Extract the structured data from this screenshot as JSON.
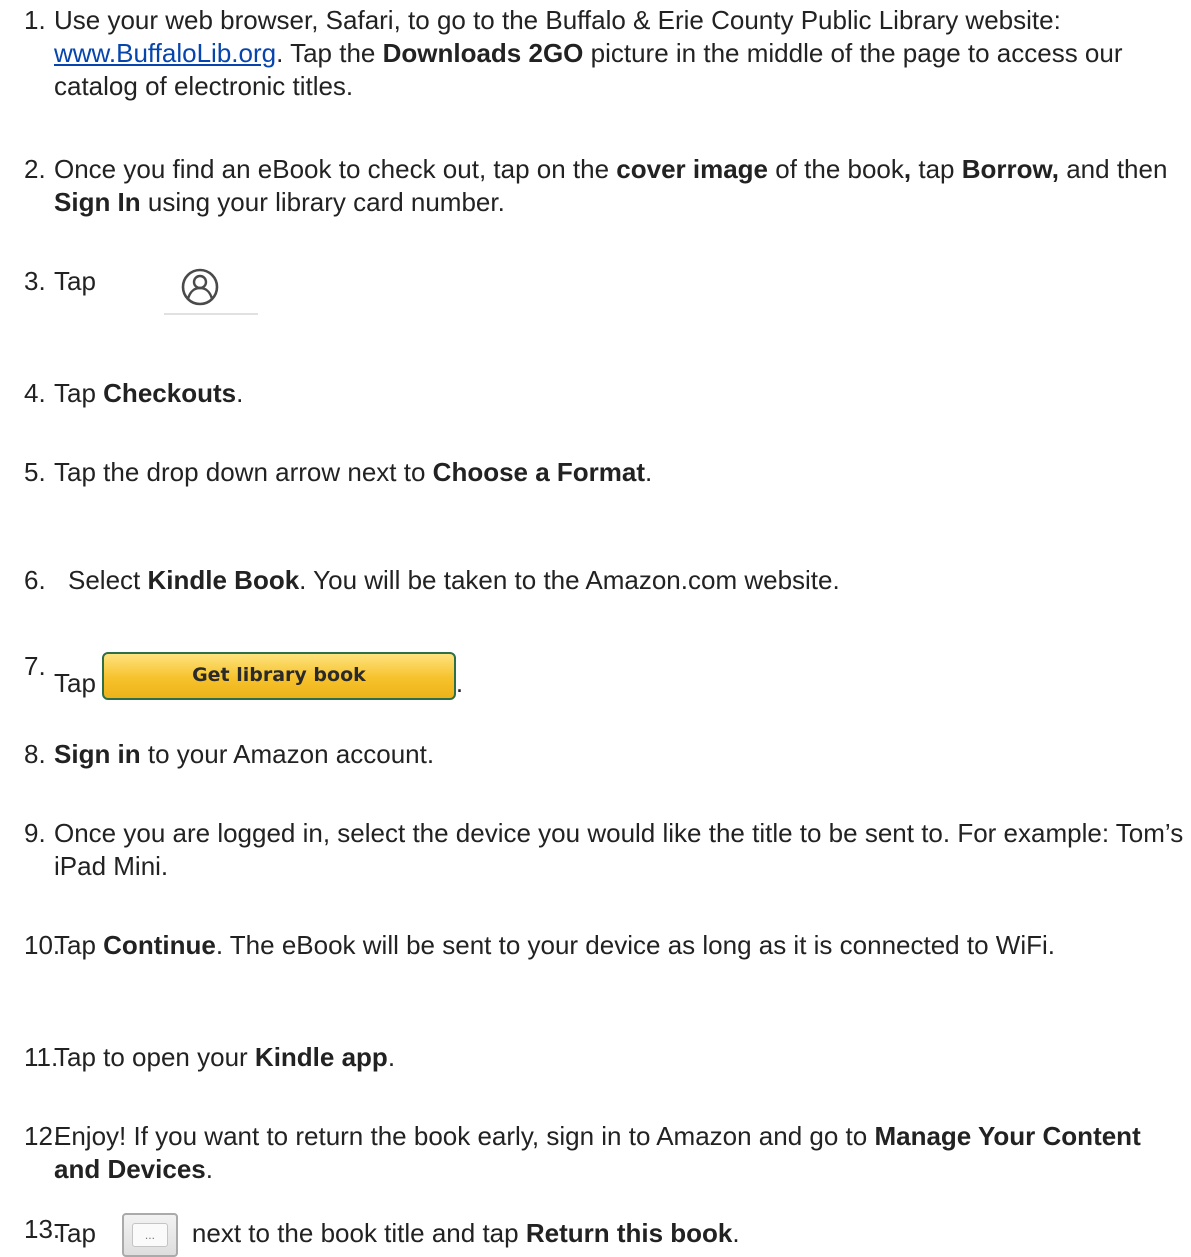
{
  "steps": [
    {
      "num": "1.",
      "parts": [
        "Use your web browser, Safari, to go to the Buffalo & Erie County Public Library website: ",
        "www.BuffaloLib.org",
        ". Tap the ",
        "Downloads 2GO",
        " picture in the middle of the page to access our catalog of electronic titles."
      ]
    },
    {
      "num": "2.",
      "parts": [
        "Once you find an eBook to check out, tap on the ",
        "cover image",
        " of the book",
        ",",
        " tap ",
        "Borrow,",
        " and then ",
        "Sign In",
        " using your library card number."
      ]
    },
    {
      "num": "3.",
      "parts": [
        "Tap"
      ]
    },
    {
      "num": "4.",
      "parts": [
        "Tap ",
        "Checkouts",
        "."
      ]
    },
    {
      "num": "5.",
      "parts": [
        "Tap the drop down arrow next to ",
        "Choose a Format",
        "."
      ]
    },
    {
      "num": "6.",
      "parts": [
        "Select ",
        "Kindle Book",
        ". You will be taken to the Amazon.com website."
      ]
    },
    {
      "num": "7.",
      "parts": [
        "Tap",
        "."
      ],
      "button_label": "Get library book"
    },
    {
      "num": "8.",
      "parts": [
        "Sign in",
        " to your Amazon account."
      ]
    },
    {
      "num": "9.",
      "parts": [
        "Once you are logged in, select the device you would like the title to be sent to. For example: Tom’s iPad Mini."
      ]
    },
    {
      "num": "10.",
      "parts": [
        "Tap ",
        "Continue",
        ". The eBook will be sent to your device as long as it is connected to WiFi."
      ]
    },
    {
      "num": "11.",
      "parts": [
        "Tap to open your ",
        "Kindle app",
        "."
      ]
    },
    {
      "num": "12.",
      "parts": [
        "Enjoy! If you want to return the book early, sign in to Amazon and go to ",
        "Manage Your Content and Devices",
        "."
      ]
    },
    {
      "num": "13.",
      "parts": [
        "Tap",
        "next to the book title and tap ",
        "Return this book",
        "."
      ],
      "button_label": "..."
    }
  ],
  "colors": {
    "link": "#0645ad",
    "button_top": "#fde37d",
    "button_bottom": "#eeb21a",
    "button_border": "#2e6f4a"
  },
  "icons": {
    "step3": "user-profile-icon",
    "step13": "more-options-icon"
  }
}
